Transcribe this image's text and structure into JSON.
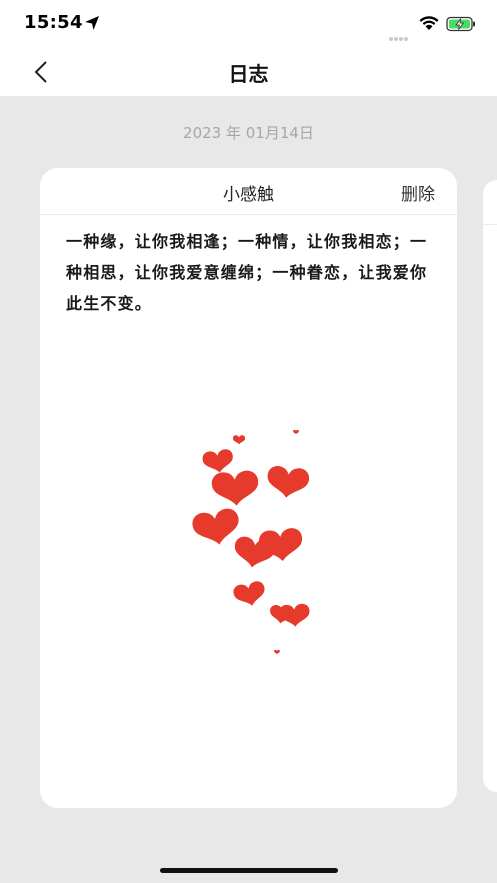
{
  "status_bar": {
    "time": "15:54"
  },
  "nav": {
    "title": "日志"
  },
  "entry": {
    "date": "2023 年 01月14日",
    "title": "小感触",
    "delete_label": "删除",
    "content": "一种缘，让你我相逢；一种情，让你我相恋；一种相思，让你我爱意缠绵；一种眷恋，让我爱你此生不变。"
  },
  "colors": {
    "background": "#e7e8e7",
    "card": "#ffffff",
    "heart": "#e53a2c",
    "date_text": "#a6a6a6"
  },
  "icons": {
    "back": "chevron-left-icon",
    "location": "location-arrow-icon",
    "wifi": "wifi-icon",
    "battery": "battery-charging-icon"
  }
}
